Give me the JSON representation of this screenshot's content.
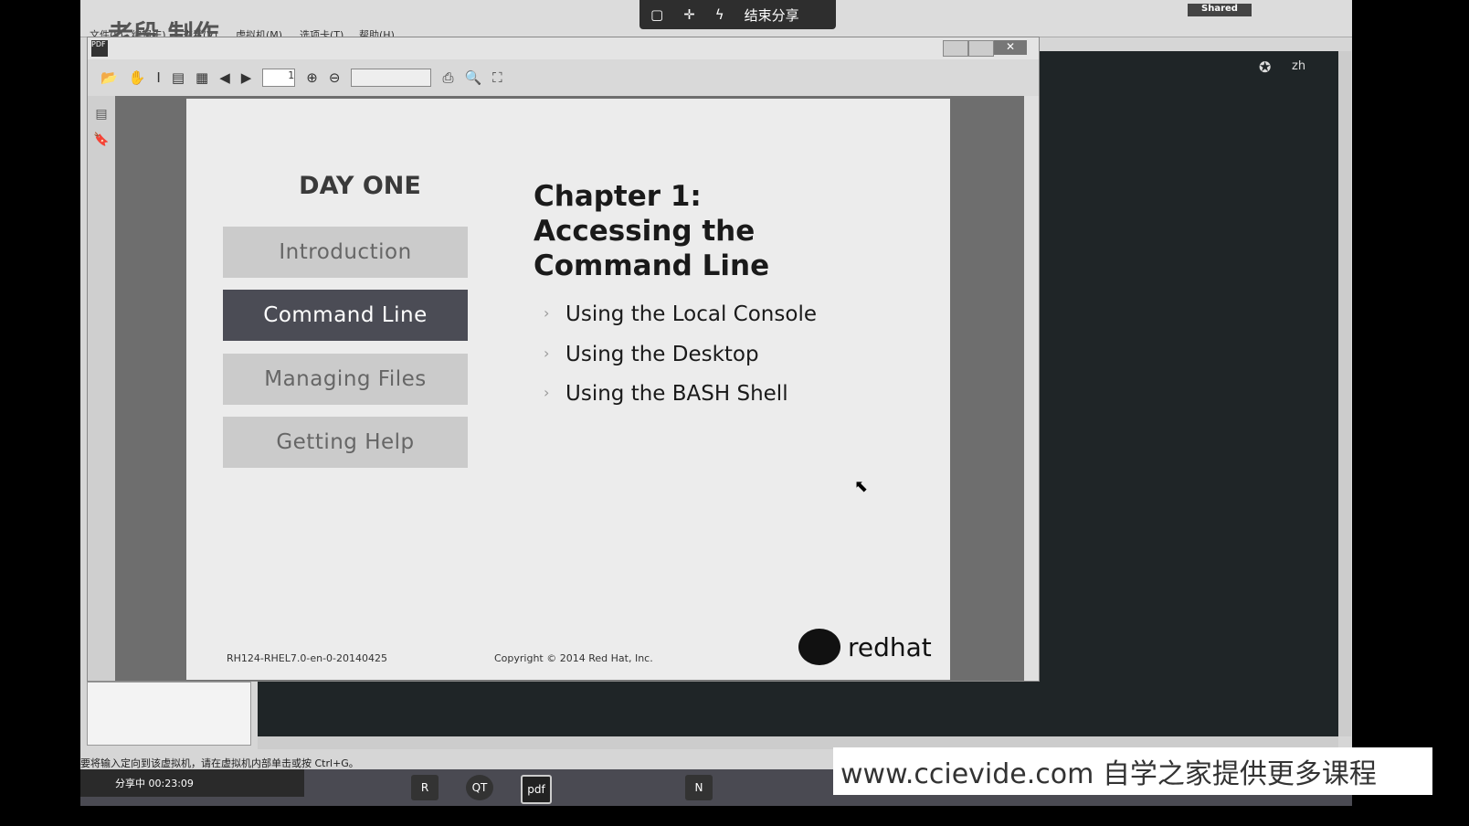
{
  "watermark": "老段 制作",
  "host_menu": [
    "文件(F)",
    "编辑(E)",
    "查看(V)",
    "虚拟机(M)",
    "选项卡(T)",
    "帮助(H)"
  ],
  "share_bar": {
    "end_share": "结束分享"
  },
  "shared_badge": "Shared",
  "vm_lang": "zh",
  "pdf": {
    "toolbar_page": "1",
    "slide": {
      "day": "DAY ONE",
      "nav": [
        {
          "label": "Introduction",
          "active": false
        },
        {
          "label": "Command Line",
          "active": true
        },
        {
          "label": "Managing Files",
          "active": false
        },
        {
          "label": "Getting Help",
          "active": false
        }
      ],
      "chapter": "Chapter 1:",
      "chapter_title": "Accessing the Command Line",
      "bullets": [
        "Using the Local Console",
        "Using the Desktop",
        "Using the BASH Shell"
      ],
      "doc_id": "RH124-RHEL7.0-en-0-20140425",
      "copyright": "Copyright © 2014 Red Hat, Inc.",
      "logo": "redhat"
    }
  },
  "status_text": "要将输入定向到该虚拟机，请在虚拟机内部单击或按 Ctrl+G。",
  "taskbar": {
    "sharing": "分享中 00:23:09",
    "apps": [
      "R",
      "QT",
      "pdf",
      "N"
    ]
  },
  "site_watermark": "www.ccievide.com  自学之家提供更多课程"
}
